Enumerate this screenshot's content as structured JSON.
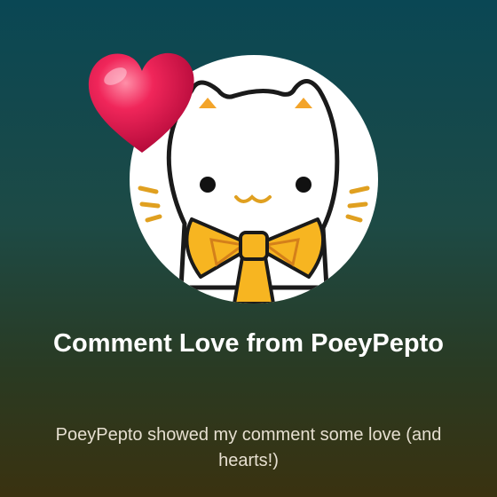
{
  "notification": {
    "title": "Comment Love from PoeyPepto",
    "message": "PoeyPepto showed my comment some love (and hearts!)",
    "avatar_icon": "cat-with-bow-avatar",
    "reaction_icon": "heart-icon"
  },
  "colors": {
    "background_top": "#0a4754",
    "background_bottom": "#3a3210",
    "heart": "#e8124e",
    "bow": "#f7b521",
    "title_text": "#ffffff",
    "message_text": "#e6dfd0"
  }
}
